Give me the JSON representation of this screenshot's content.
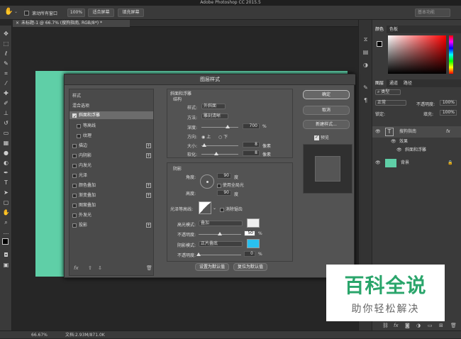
{
  "app": {
    "title": "Adobe Photoshop CC 2015.5"
  },
  "options_bar": {
    "scroll_all_windows": "滚动所有窗口",
    "zoom_100": "100%",
    "fit_screen": "适合屏幕",
    "fill_screen": "填充屏幕",
    "search_placeholder": "基本功能"
  },
  "document": {
    "tab_label": "未标题-1 @ 66.7% (搜狗指南, RGB/8*) *"
  },
  "status": {
    "zoom": "66.67%",
    "doc_size": "文档:2.93M/871.0K"
  },
  "colors": {
    "accent": "#5fcfa7",
    "shadow_color": "#29c0ef",
    "highlight_color": "#efefef"
  },
  "right_panel": {
    "color_tabs": [
      "颜色",
      "色板"
    ],
    "layer_tabs": [
      "图层",
      "通道",
      "路径"
    ],
    "kind_filter": "类型",
    "blend_mode": "正常",
    "opacity_label": "不透明度:",
    "opacity_value": "100%",
    "lock_label": "锁定:",
    "fill_label": "填充:",
    "fill_value": "100%",
    "layers": [
      {
        "name": "搜狗指南",
        "type": "T"
      },
      {
        "name": "效果"
      },
      {
        "name": "斜面和浮雕"
      },
      {
        "name": "背景"
      }
    ]
  },
  "dialog": {
    "title": "图层样式",
    "styles_header": "样式",
    "blend_options": "混合选项",
    "styles": [
      {
        "label": "斜面和浮雕",
        "checked": true,
        "selected": true
      },
      {
        "label": "等高线",
        "checked": false
      },
      {
        "label": "纹理",
        "checked": false
      },
      {
        "label": "描边",
        "checked": false,
        "plus": true
      },
      {
        "label": "内阴影",
        "checked": false,
        "plus": true
      },
      {
        "label": "内发光",
        "checked": false
      },
      {
        "label": "光泽",
        "checked": false
      },
      {
        "label": "颜色叠加",
        "checked": false,
        "plus": true
      },
      {
        "label": "渐变叠加",
        "checked": false,
        "plus": true
      },
      {
        "label": "图案叠加",
        "checked": false
      },
      {
        "label": "外发光",
        "checked": false
      },
      {
        "label": "投影",
        "checked": false,
        "plus": true
      }
    ],
    "fx_label": "fx",
    "section_title": "斜面和浮雕",
    "structure_label": "结构",
    "style_label": "样式:",
    "style_value": "外斜面",
    "technique_label": "方法:",
    "technique_value": "雕刻清晰",
    "depth_label": "深度:",
    "depth_value": "700",
    "depth_unit": "%",
    "direction_label": "方向:",
    "dir_up": "上",
    "dir_down": "下",
    "size_label": "大小:",
    "size_value": "8",
    "size_unit": "像素",
    "soften_label": "软化:",
    "soften_value": "8",
    "soften_unit": "像素",
    "shading_label": "阴影",
    "angle_label": "角度:",
    "angle_value": "90",
    "angle_unit": "度",
    "global_light": "使用全局光",
    "altitude_label": "高度:",
    "altitude_value": "90",
    "altitude_unit": "度",
    "gloss_label": "光泽等高线:",
    "anti_alias": "消除锯齿",
    "hl_mode_label": "高光模式:",
    "hl_mode_value": "叠加",
    "hl_opacity_label": "不透明度:",
    "hl_opacity_value": "50",
    "hl_opacity_unit": "%",
    "sh_mode_label": "阴影模式:",
    "sh_mode_value": "正片叠底",
    "sh_opacity_label": "不透明度:",
    "sh_opacity_value": "0",
    "sh_opacity_unit": "%",
    "make_default": "设置为默认值",
    "reset_default": "复位为默认值",
    "ok": "确定",
    "cancel": "取消",
    "new_style": "新建样式...",
    "preview": "预览"
  },
  "watermark": {
    "main": "百科全说",
    "sub": "助你轻松解决"
  }
}
